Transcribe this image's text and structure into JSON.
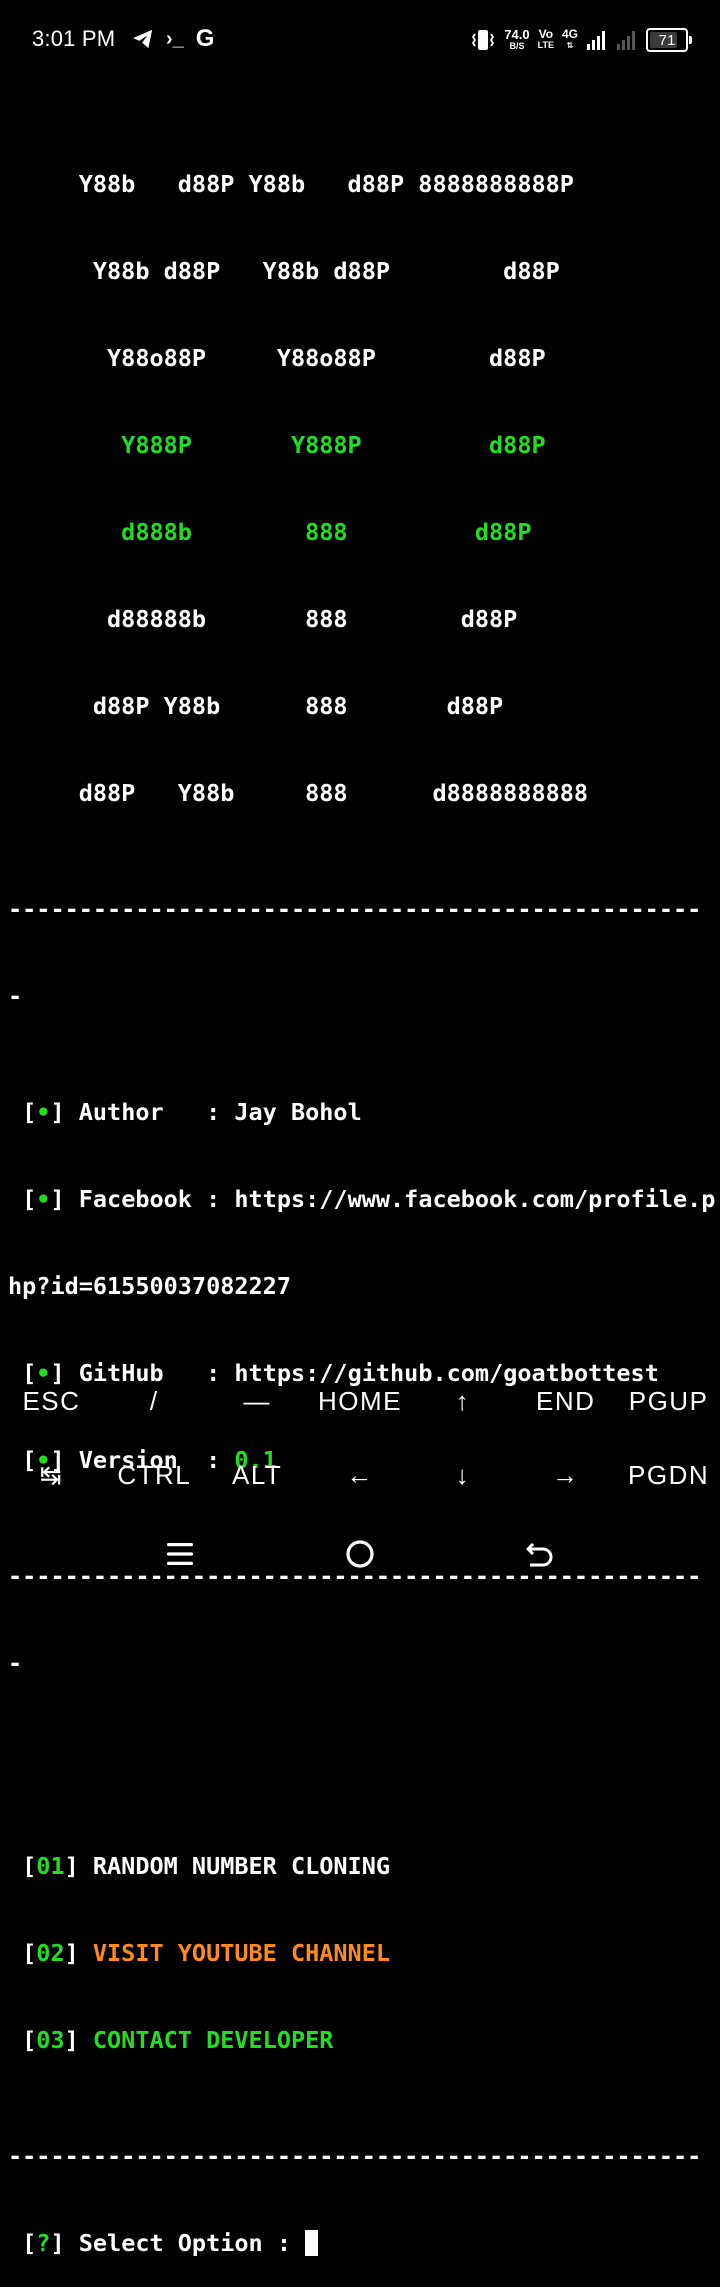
{
  "status_bar": {
    "time": "3:01 PM",
    "left_icons": [
      "telegram-icon",
      "terminal-prompt-icon",
      "google-icon"
    ],
    "terminal_glyph": "›_",
    "google_glyph": "G",
    "net_speed_value": "74.0",
    "net_speed_unit": "B/S",
    "volte_top": "Vo",
    "volte_bottom": "LTE",
    "network_type": "4G",
    "battery": "71"
  },
  "terminal": {
    "banner": [
      "     Y88b   d88P Y88b   d88P 8888888888P",
      "      Y88b d88P   Y88b d88P        d88P",
      "       Y88o88P     Y88o88P        d88P",
      "        Y888P       Y888P         d88P",
      "        d888b        888         d88P",
      "       d88888b       888        d88P",
      "      d88P Y88b      888       d88P",
      "     d88P   Y88b     888      d8888888888"
    ],
    "separator": "-------------------------------------------------",
    "separator_wrap": "-",
    "bullet_open": " [",
    "bullet_dot": "•",
    "bullet_close": "] ",
    "info": {
      "author_label": "Author   : ",
      "author_value": "Jay Bohol",
      "facebook_label": "Facebook : ",
      "facebook_value_line1": "https://www.facebook.com/profile.p",
      "facebook_value_line2": "hp?id=61550037082227",
      "github_label": "GitHub   : ",
      "github_value": "https://github.com/goatbottest",
      "version_label": "Version  : ",
      "version_value": "0.1"
    },
    "menu": [
      {
        "num": "01",
        "label": "RANDOM NUMBER CLONING"
      },
      {
        "num": "02",
        "label": "VISIT YOUTUBE CHANNEL"
      },
      {
        "num": "03",
        "label": "CONTACT DEVELOPER"
      }
    ],
    "prompt_mark": "?",
    "prompt_text": "Select Option : "
  },
  "extra_keys": {
    "row1": [
      "ESC",
      "/",
      "—",
      "HOME",
      "↑",
      "END",
      "PGUP"
    ],
    "row2": [
      "↹",
      "CTRL",
      "ALT",
      "←",
      "↓",
      "→",
      "PGDN"
    ]
  },
  "nav_bar": [
    "menu-icon",
    "home-circle-icon",
    "back-icon"
  ]
}
